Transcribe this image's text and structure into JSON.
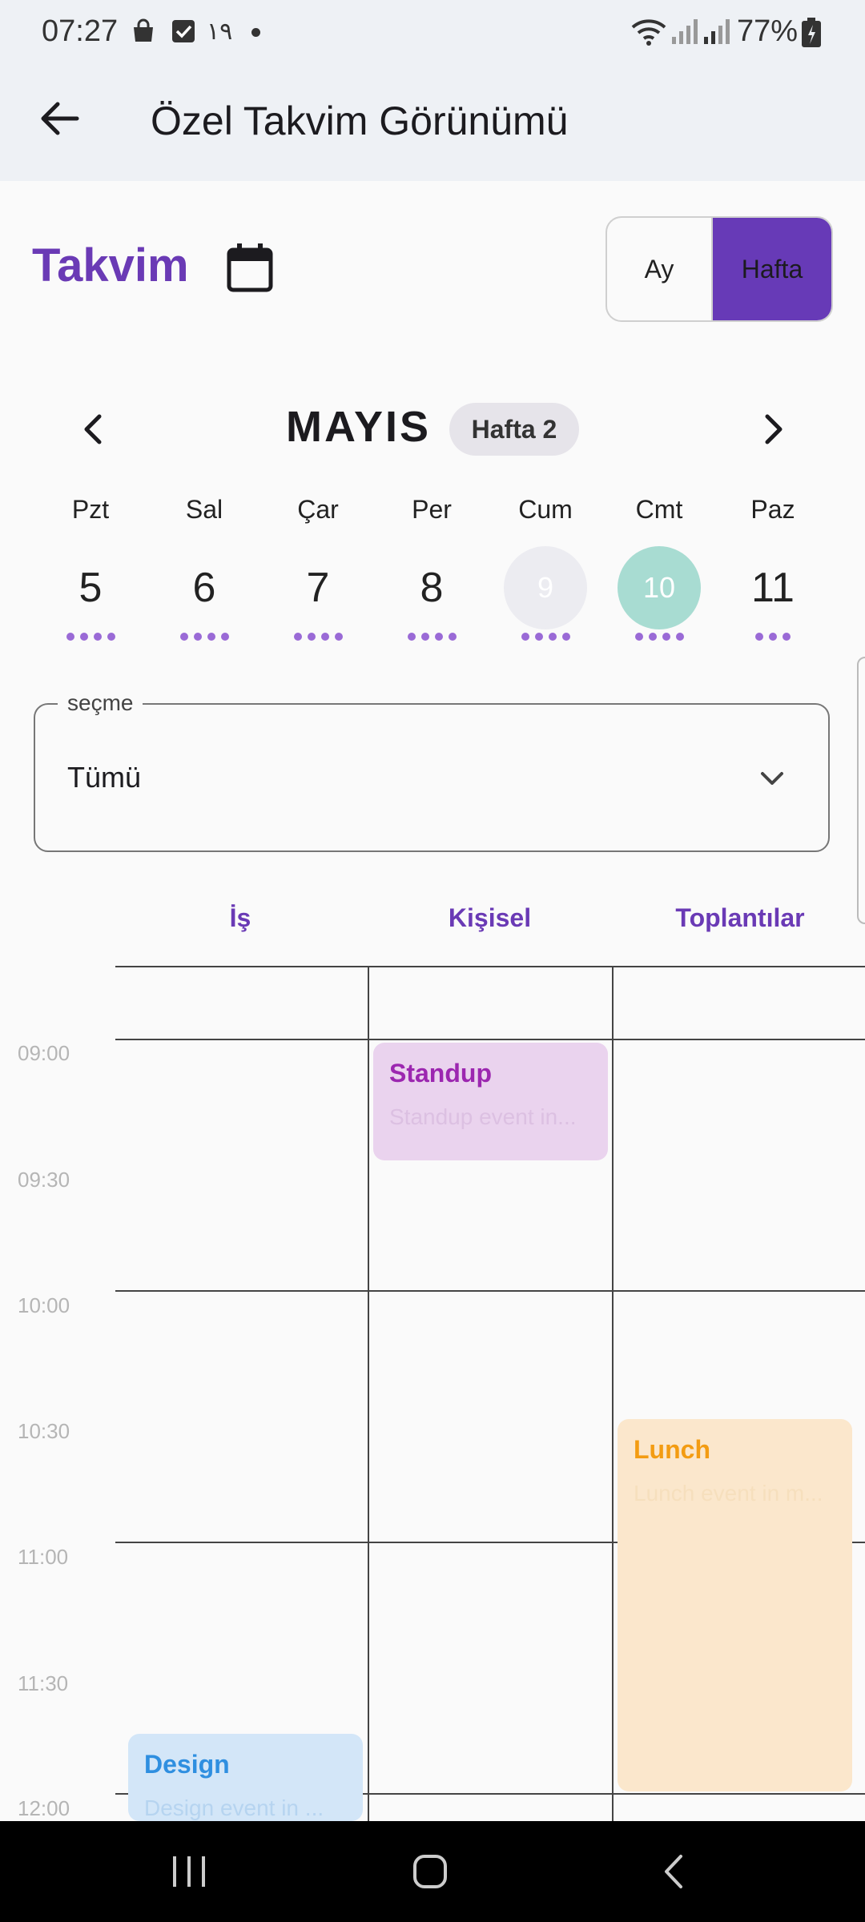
{
  "status_bar": {
    "time": "07:27",
    "notif_text": "١٩",
    "battery": "77%",
    "icons": [
      "shopping-bag-icon",
      "checkbox-icon",
      "dot-icon",
      "wifi-icon",
      "signal-icon",
      "signal-icon",
      "battery-icon"
    ]
  },
  "app_bar": {
    "title": "Özel Takvim Görünümü",
    "back_icon": "arrow-left-icon"
  },
  "header": {
    "title": "Takvim",
    "calendar_icon": "calendar-icon",
    "view_toggle": {
      "month": "Ay",
      "week": "Hafta",
      "selected": "Hafta"
    }
  },
  "week_nav": {
    "month": "MAYIS",
    "week_badge": "Hafta 2",
    "prev_icon": "chevron-left-icon",
    "next_icon": "chevron-right-icon",
    "days": [
      {
        "dow": "Pzt",
        "num": "5",
        "dots": 4,
        "state": "normal"
      },
      {
        "dow": "Sal",
        "num": "6",
        "dots": 4,
        "state": "normal"
      },
      {
        "dow": "Çar",
        "num": "7",
        "dots": 4,
        "state": "normal"
      },
      {
        "dow": "Per",
        "num": "8",
        "dots": 4,
        "state": "normal"
      },
      {
        "dow": "Cum",
        "num": "9",
        "dots": 4,
        "state": "dimmed"
      },
      {
        "dow": "Cmt",
        "num": "10",
        "dots": 4,
        "state": "today"
      },
      {
        "dow": "Paz",
        "num": "11",
        "dots": 3,
        "state": "normal"
      }
    ]
  },
  "filter": {
    "label": "seçme",
    "value": "Tümü",
    "icon": "chevron-down-icon"
  },
  "schedule": {
    "categories": [
      "İş",
      "Kişisel",
      "Toplantılar"
    ],
    "times": [
      "09:00",
      "09:30",
      "10:00",
      "10:30",
      "11:00",
      "11:30",
      "12:00"
    ],
    "events": [
      {
        "title": "Standup",
        "subtitle": "Standup event in...",
        "category": "Kişisel",
        "color": "#9c27b0",
        "bg": "#ead3ee"
      },
      {
        "title": "Lunch",
        "subtitle": "Lunch event in m...",
        "category": "Toplantılar",
        "color": "#f39c12",
        "bg": "#fbe7cc"
      },
      {
        "title": "Design",
        "subtitle": "Design event in ...",
        "category": "İş",
        "color": "#2f8fe0",
        "bg": "#d3e6f8"
      }
    ]
  },
  "nav_bar": {
    "icons": [
      "recent-apps-icon",
      "home-icon",
      "back-icon"
    ]
  },
  "colors": {
    "accent": "#673ab7",
    "today": "#a8dcd2",
    "dot": "#9a6ad6"
  }
}
